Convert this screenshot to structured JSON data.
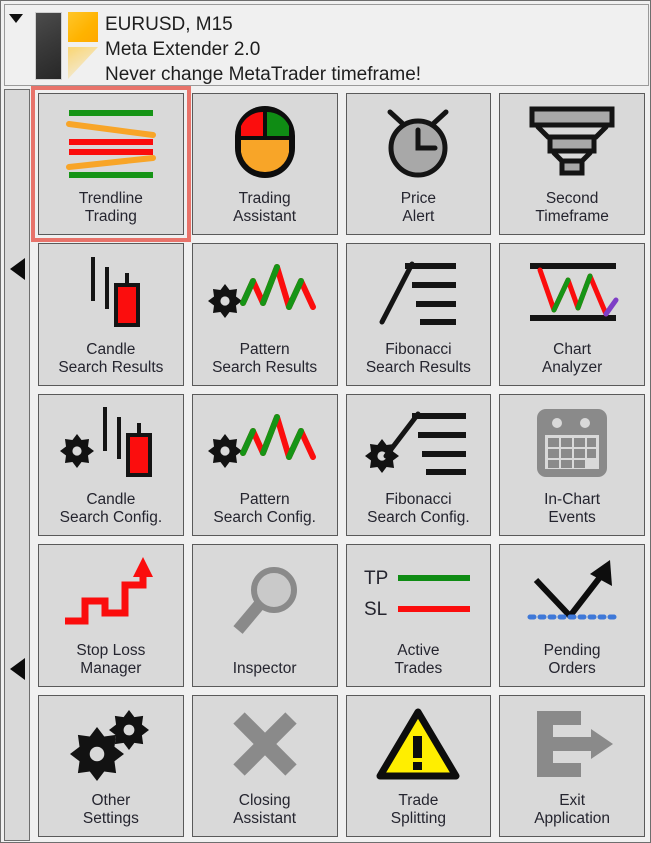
{
  "window": {
    "collapse_icon": "chevron-down-icon",
    "logo": {
      "name": "meta-extender-logo",
      "dark_bar_color": "#3a3a3a",
      "accent_color": "#ffb300"
    }
  },
  "header": {
    "line1": "EURUSD, M15",
    "line2": "Meta Extender 2.0",
    "line3": "Never change MetaTrader timeframe!"
  },
  "rail": {
    "arrow_top_icon": "caret-left-icon",
    "arrow_bottom_icon": "caret-left-icon"
  },
  "colors": {
    "panel_bg": "#f0f0f0",
    "tile_bg": "#d9d9d9",
    "tile_border": "#5a5a5a",
    "selection": "#e8736a",
    "label_text": "#25252f",
    "bull_green": "#169416",
    "bear_red": "#fb0d0d",
    "orange": "#f8a528",
    "purple": "#7e3ec6",
    "disabled_gray": "#8a8a8a",
    "warning_yellow": "#ffee00",
    "dotted_blue": "#3e78d8"
  },
  "tiles": [
    {
      "id": "trendline-trading",
      "label": "Trendline\nTrading",
      "icon": "trendline-icon",
      "selected": true,
      "disabled": false
    },
    {
      "id": "trading-assistant",
      "label": "Trading\nAssistant",
      "icon": "mouse-icon",
      "selected": false,
      "disabled": false
    },
    {
      "id": "price-alert",
      "label": "Price\nAlert",
      "icon": "alarm-clock-icon",
      "selected": false,
      "disabled": false
    },
    {
      "id": "second-timeframe",
      "label": "Second\nTimeframe",
      "icon": "funnel-icon",
      "selected": false,
      "disabled": false
    },
    {
      "id": "candle-search-results",
      "label": "Candle\nSearch Results",
      "icon": "candlestick-icon",
      "selected": false,
      "disabled": false
    },
    {
      "id": "pattern-search-results",
      "label": "Pattern\nSearch Results",
      "icon": "zigzag-gear-icon",
      "selected": false,
      "disabled": false
    },
    {
      "id": "fibonacci-search-results",
      "label": "Fibonacci\nSearch Results",
      "icon": "fibonacci-icon",
      "selected": false,
      "disabled": false
    },
    {
      "id": "chart-analyzer",
      "label": "Chart\nAnalyzer",
      "icon": "chart-analyzer-icon",
      "selected": false,
      "disabled": false
    },
    {
      "id": "candle-search-config",
      "label": "Candle\nSearch Config.",
      "icon": "candlestick-gear-icon",
      "selected": false,
      "disabled": false
    },
    {
      "id": "pattern-search-config",
      "label": "Pattern\nSearch Config.",
      "icon": "zigzag-gear-icon",
      "selected": false,
      "disabled": false
    },
    {
      "id": "fibonacci-search-config",
      "label": "Fibonacci\nSearch Config.",
      "icon": "fibonacci-gear-icon",
      "selected": false,
      "disabled": false
    },
    {
      "id": "in-chart-events",
      "label": "In-Chart\nEvents",
      "icon": "calendar-icon",
      "selected": false,
      "disabled": true
    },
    {
      "id": "stop-loss-manager",
      "label": "Stop Loss\nManager",
      "icon": "staircase-arrow-icon",
      "selected": false,
      "disabled": false
    },
    {
      "id": "inspector",
      "label": "Inspector",
      "icon": "magnifier-icon",
      "selected": false,
      "disabled": true
    },
    {
      "id": "active-trades",
      "label": "Active\nTrades",
      "icon": "tp-sl-legend-icon",
      "selected": false,
      "disabled": false
    },
    {
      "id": "pending-orders",
      "label": "Pending\nOrders",
      "icon": "pending-arrow-icon",
      "selected": false,
      "disabled": false
    },
    {
      "id": "other-settings",
      "label": "Other\nSettings",
      "icon": "gears-icon",
      "selected": false,
      "disabled": false
    },
    {
      "id": "closing-assistant",
      "label": "Closing\nAssistant",
      "icon": "close-x-icon",
      "selected": false,
      "disabled": true
    },
    {
      "id": "trade-splitting",
      "label": "Trade\nSplitting",
      "icon": "warning-triangle-icon",
      "selected": false,
      "disabled": false
    },
    {
      "id": "exit-application",
      "label": "Exit\nApplication",
      "icon": "exit-icon",
      "selected": false,
      "disabled": true
    }
  ],
  "icon_legend": {
    "active_trades_tp": "TP",
    "active_trades_sl": "SL",
    "warning_glyph": "!"
  }
}
